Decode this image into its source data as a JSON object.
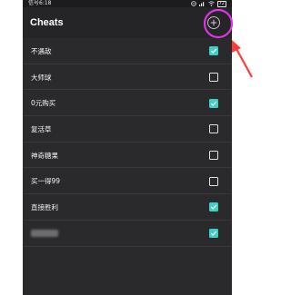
{
  "status_bar": {
    "left": "信号6:18",
    "battery": "72"
  },
  "app_bar": {
    "title": "Cheats"
  },
  "cheats": [
    {
      "label": "不遇敌",
      "checked": true
    },
    {
      "label": "大师球",
      "checked": false
    },
    {
      "label": "0元购买",
      "checked": true
    },
    {
      "label": "复活草",
      "checked": false
    },
    {
      "label": "神奇糖果",
      "checked": false
    },
    {
      "label": "买一得99",
      "checked": false
    },
    {
      "label": "直接胜利",
      "checked": true
    },
    {
      "label": "",
      "checked": true,
      "obscured": true
    }
  ],
  "colors": {
    "checkbox_checked": "#3fd0c4",
    "annotation": "#e033e8",
    "arrow": "#ff3b3b"
  },
  "icons": {
    "add": "plus-circle-icon"
  }
}
